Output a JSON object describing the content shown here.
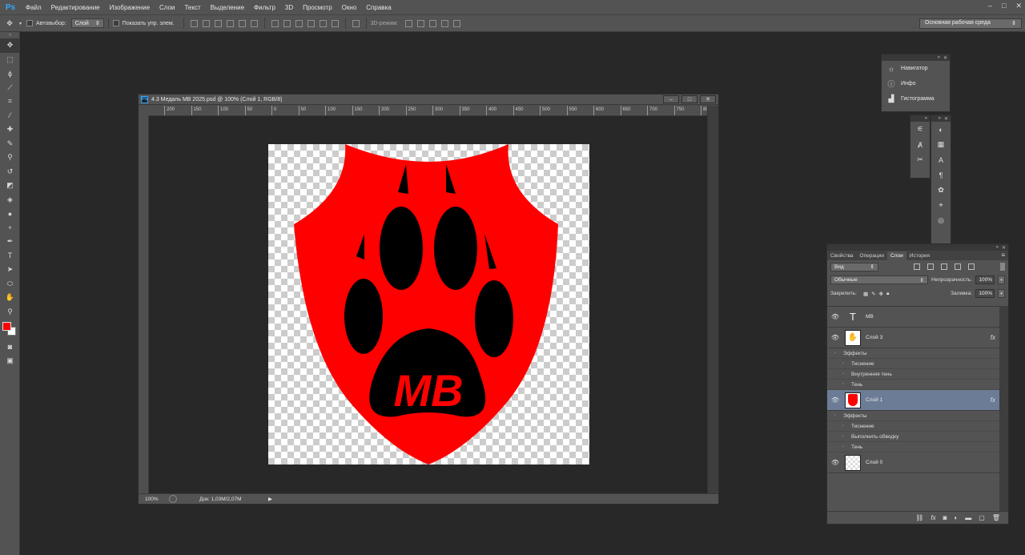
{
  "app": {
    "logo": "Ps",
    "menu": [
      "Файл",
      "Редактирование",
      "Изображение",
      "Слои",
      "Текст",
      "Выделение",
      "Фильтр",
      "3D",
      "Просмотр",
      "Окно",
      "Справка"
    ],
    "window_controls": [
      "–",
      "□",
      "✕"
    ]
  },
  "options": {
    "autoselect_label": "Автовыбор:",
    "autoselect_value": "Слой",
    "show_controls_label": "Показать упр. элем.",
    "mode_3d_label": "3D-режим:",
    "workspace": "Основная рабочая среда"
  },
  "document": {
    "title": "4.3 Медаль МВ 2025.psd @ 100% (Слой 1, RGB/8)",
    "ps_icon": "Ps",
    "zoom": "100%",
    "doc_size": "Док: 1,03M/2,07M",
    "ruler_labels": [
      "200",
      "150",
      "100",
      "50",
      "0",
      "50",
      "100",
      "150",
      "200",
      "250",
      "300",
      "350",
      "400",
      "450",
      "500",
      "550",
      "600",
      "650",
      "700",
      "750",
      "800"
    ],
    "artwork_text": "MB",
    "colors": {
      "shield": "#ff0000",
      "paw": "#000000",
      "text": "#ff0000"
    }
  },
  "panels": {
    "mini": [
      {
        "icon": "☼",
        "label": "Навигатор"
      },
      {
        "icon": "ⓘ",
        "label": "Инфо"
      },
      {
        "icon": "▟",
        "label": "Гистограмма"
      }
    ]
  },
  "layers_panel": {
    "tabs": [
      "Свойства",
      "Операции",
      "Слои",
      "История"
    ],
    "active_tab": "Слои",
    "filter": "Вид",
    "blend_mode": "Обычные",
    "opacity_label": "Непрозрачность:",
    "opacity": "100%",
    "lock_label": "Закрепить:",
    "fill_label": "Заливка:",
    "fill": "100%",
    "layers": [
      {
        "name": "МВ",
        "type": "text"
      },
      {
        "name": "Слой 3",
        "type": "paw",
        "effects_label": "Эффекты",
        "effects": [
          "Тиснение",
          "Внутренняя тень",
          "Тень"
        ]
      },
      {
        "name": "Слой 1",
        "type": "shield",
        "selected": true,
        "effects_label": "Эффекты",
        "effects": [
          "Тиснение",
          "Выполнить обводку",
          "Тень"
        ]
      },
      {
        "name": "Слой 0",
        "type": "empty"
      }
    ]
  }
}
